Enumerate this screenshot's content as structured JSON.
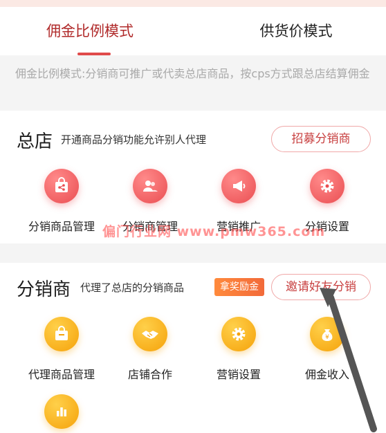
{
  "tabs": [
    {
      "label": "佣金比例模式",
      "active": true
    },
    {
      "label": "供货价模式",
      "active": false
    }
  ],
  "description": "佣金比例模式:分销商可推广或代卖总店商品，按cps方式跟总店结算佣金",
  "headquarters": {
    "title": "总店",
    "subtitle": "开通商品分销功能允许别人代理",
    "recruit_button": "招募分销商",
    "items": [
      {
        "label": "分销商品管理",
        "icon": "share-bag-icon"
      },
      {
        "label": "分销商管理",
        "icon": "users-icon"
      },
      {
        "label": "营销推广",
        "icon": "megaphone-icon"
      },
      {
        "label": "分销设置",
        "icon": "gear-icon"
      }
    ]
  },
  "distributor": {
    "title": "分销商",
    "subtitle": "代理了总店的分销商品",
    "reward_badge": "拿奖励金",
    "invite_button": "邀请好友分销",
    "items": [
      {
        "label": "代理商品管理",
        "icon": "shopping-bag-icon"
      },
      {
        "label": "店铺合作",
        "icon": "handshake-icon"
      },
      {
        "label": "营销设置",
        "icon": "gear-icon"
      },
      {
        "label": "佣金收入",
        "icon": "money-bag-icon"
      },
      {
        "label": "",
        "icon": "bar-chart-icon"
      }
    ]
  },
  "watermark": "偏门行业网 www.pmw365.com",
  "colors": {
    "accent_red": "#e04a4a",
    "active_tab_text": "#b02a2a",
    "icon_red": "#ea4e52",
    "icon_yellow": "#f5a20a",
    "badge_orange": "#f26a3a"
  }
}
